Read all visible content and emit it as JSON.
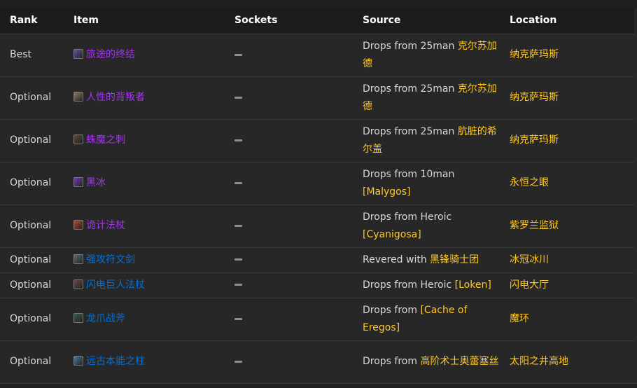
{
  "headers": {
    "rank": "Rank",
    "item": "Item",
    "sockets": "Sockets",
    "source": "Source",
    "location": "Location"
  },
  "rows": [
    {
      "rank": "Best",
      "item": "旅途的终结",
      "quality": "epic",
      "icon": "staff-icon",
      "icon_color": "#6a4fa0",
      "source_prefix": "Drops from 25man ",
      "source_link": "克尔苏加德",
      "location": "纳克萨玛斯",
      "size": "tall"
    },
    {
      "rank": "Optional",
      "item": "人性的背叛者",
      "quality": "epic",
      "icon": "skull-icon",
      "icon_color": "#8a8060",
      "source_prefix": "Drops from 25man ",
      "source_link": "克尔苏加德",
      "location": "纳克萨玛斯",
      "size": "tall"
    },
    {
      "rank": "Optional",
      "item": "蛛魔之刺",
      "quality": "epic",
      "icon": "dagger-icon",
      "icon_color": "#5a4a3a",
      "source_prefix": "Drops from 25man ",
      "source_link": "肮脏的希尔盖",
      "location": "纳克萨玛斯",
      "size": "tall"
    },
    {
      "rank": "Optional",
      "item": "黑冰",
      "quality": "epic",
      "icon": "ice-icon",
      "icon_color": "#7a3ab0",
      "source_prefix": "Drops from 10man ",
      "source_link": "[Malygos]",
      "location": "永恒之眼",
      "size": "tall"
    },
    {
      "rank": "Optional",
      "item": "诡计法杖",
      "quality": "epic",
      "icon": "flame-staff-icon",
      "icon_color": "#b0502a",
      "source_prefix": "Drops from Heroic ",
      "source_link": "[Cyanigosa]",
      "location": "紫罗兰监狱",
      "size": "tall"
    },
    {
      "rank": "Optional",
      "item": "强攻符文剑",
      "quality": "rare",
      "icon": "sword-icon",
      "icon_color": "#5a6a7a",
      "source_prefix": "Revered with ",
      "source_link": "黑锋骑士团",
      "location": "冰冠冰川",
      "size": "short"
    },
    {
      "rank": "Optional",
      "item": "闪电巨人法杖",
      "quality": "rare",
      "icon": "lightning-staff-icon",
      "icon_color": "#6a4a4a",
      "source_prefix": "Drops from Heroic ",
      "source_link": "[Loken]",
      "location": "闪电大厅",
      "size": "short"
    },
    {
      "rank": "Optional",
      "item": "龙爪战斧",
      "quality": "rare",
      "icon": "axe-icon",
      "icon_color": "#3a5a4a",
      "source_prefix": "Drops from ",
      "source_link": "[Cache of Eregos]",
      "location": "魔环",
      "size": "tall"
    },
    {
      "rank": "Optional",
      "item": "远古本能之柱",
      "quality": "rare",
      "icon": "pillar-icon",
      "icon_color": "#4a7aa0",
      "source_prefix": "Drops from ",
      "source_link": "高阶术士奥蕾塞丝",
      "location": "太阳之井高地",
      "size": "tall"
    }
  ]
}
